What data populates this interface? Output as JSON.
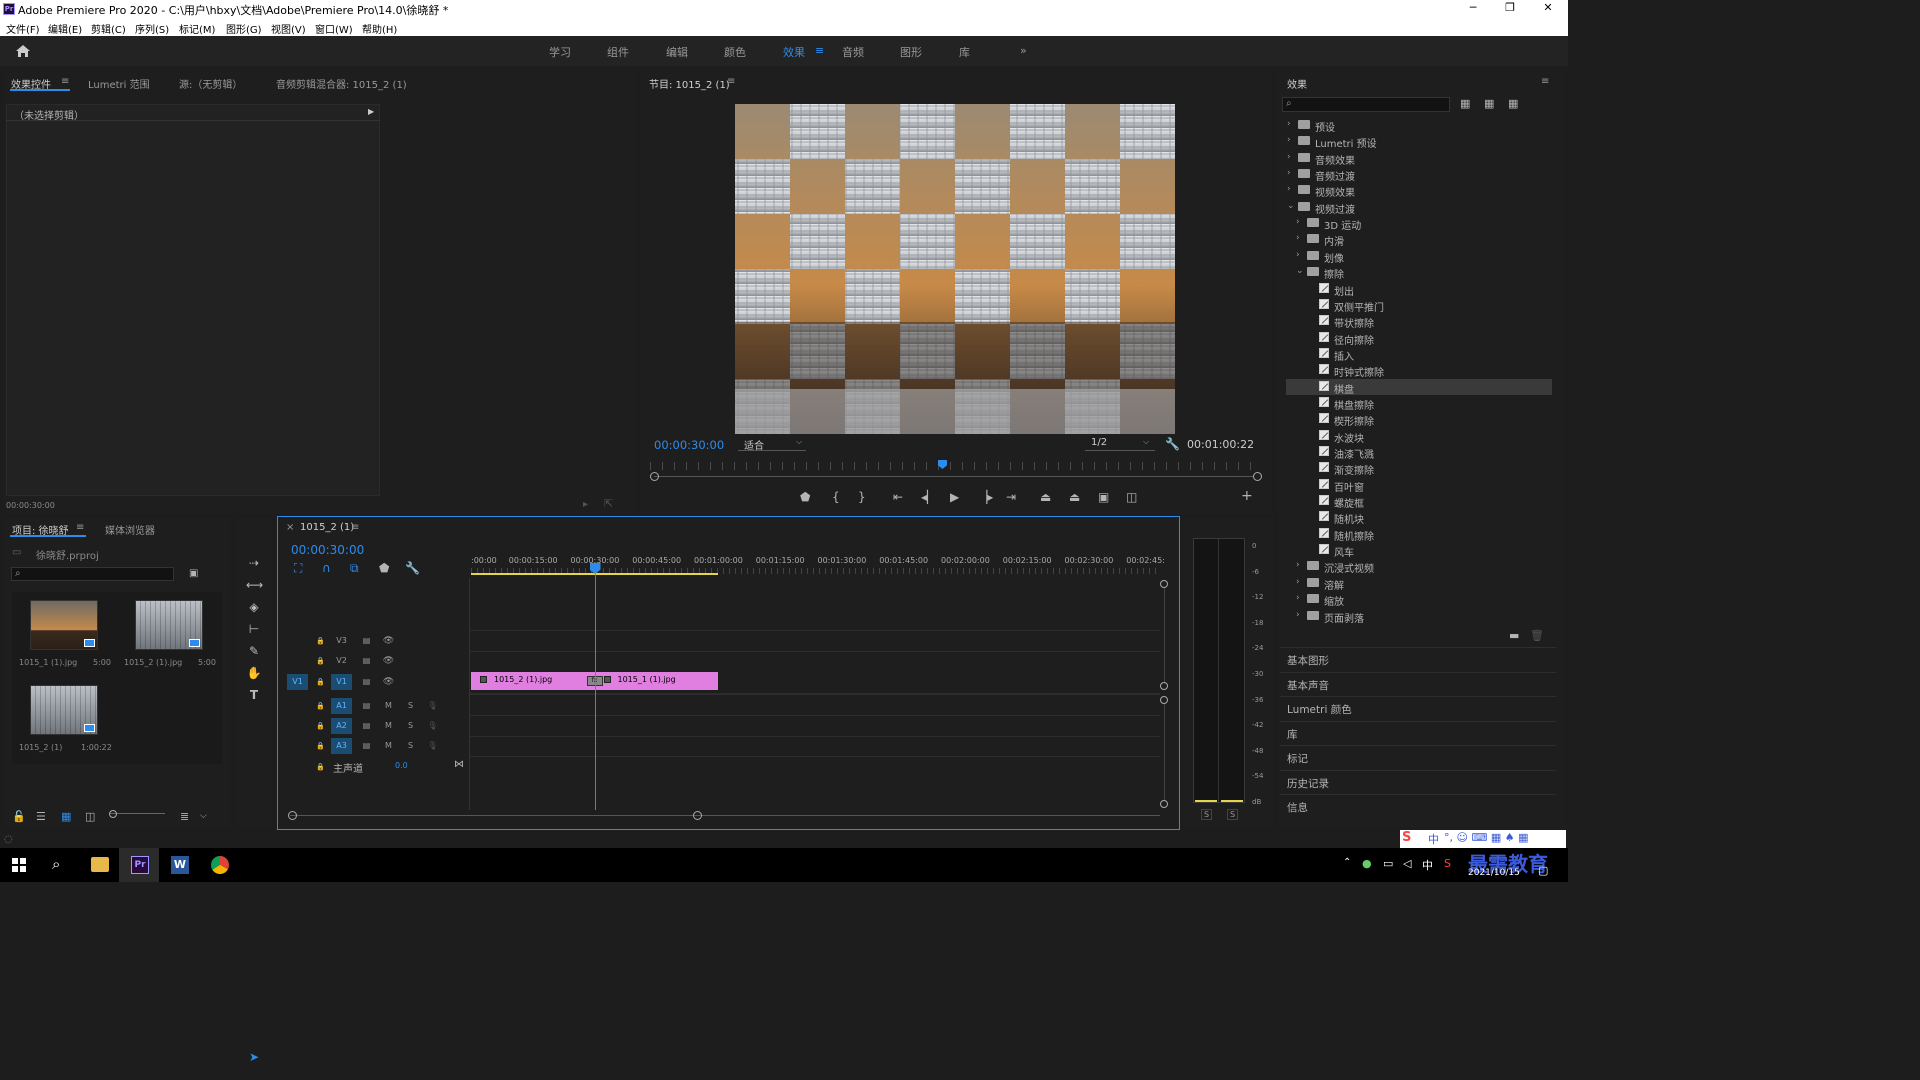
{
  "window": {
    "title": "Adobe Premiere Pro 2020 - C:\\用户\\hbxy\\文档\\Adobe\\Premiere Pro\\14.0\\徐晓舒 *",
    "logo": "Pr",
    "min": "─",
    "max": "❐",
    "close": "✕"
  },
  "menu": [
    "文件(F)",
    "编辑(E)",
    "剪辑(C)",
    "序列(S)",
    "标记(M)",
    "图形(G)",
    "视图(V)",
    "窗口(W)",
    "帮助(H)"
  ],
  "workspaces": [
    "学习",
    "组件",
    "编辑",
    "颜色",
    "效果",
    "音频",
    "图形",
    "库"
  ],
  "workspace_active": "效果",
  "workspace_more": "»",
  "source_panel": {
    "tabs": [
      "效果控件",
      "Lumetri 范围",
      "源:（无剪辑）",
      "音频剪辑混合器: 1015_2 (1)"
    ],
    "no_clip": "（未选择剪辑）",
    "timecode": "00:00:30:00"
  },
  "program": {
    "title": "节目: 1015_2 (1)",
    "timecode": "00:00:30:00",
    "fit": "适合",
    "resolution": "1/2",
    "duration": "00:01:00:22",
    "playhead_fraction": 0.48
  },
  "effects_panel": {
    "title": "效果",
    "items": [
      {
        "label": "预设",
        "level": 0,
        "kind": "folder",
        "open": false
      },
      {
        "label": "Lumetri 预设",
        "level": 0,
        "kind": "folder",
        "open": false
      },
      {
        "label": "音频效果",
        "level": 0,
        "kind": "folder",
        "open": false
      },
      {
        "label": "音频过渡",
        "level": 0,
        "kind": "folder",
        "open": false
      },
      {
        "label": "视频效果",
        "level": 0,
        "kind": "folder",
        "open": false
      },
      {
        "label": "视频过渡",
        "level": 0,
        "kind": "folder",
        "open": true
      },
      {
        "label": "3D 运动",
        "level": 1,
        "kind": "folder",
        "open": false
      },
      {
        "label": "内滑",
        "level": 1,
        "kind": "folder",
        "open": false
      },
      {
        "label": "划像",
        "level": 1,
        "kind": "folder",
        "open": false
      },
      {
        "label": "擦除",
        "level": 1,
        "kind": "folder",
        "open": true
      },
      {
        "label": "划出",
        "level": 2,
        "kind": "effect"
      },
      {
        "label": "双侧平推门",
        "level": 2,
        "kind": "effect"
      },
      {
        "label": "带状擦除",
        "level": 2,
        "kind": "effect"
      },
      {
        "label": "径向擦除",
        "level": 2,
        "kind": "effect"
      },
      {
        "label": "插入",
        "level": 2,
        "kind": "effect"
      },
      {
        "label": "时钟式擦除",
        "level": 2,
        "kind": "effect"
      },
      {
        "label": "棋盘",
        "level": 2,
        "kind": "effect",
        "selected": true
      },
      {
        "label": "棋盘擦除",
        "level": 2,
        "kind": "effect"
      },
      {
        "label": "楔形擦除",
        "level": 2,
        "kind": "effect"
      },
      {
        "label": "水波块",
        "level": 2,
        "kind": "effect"
      },
      {
        "label": "油漆飞溅",
        "level": 2,
        "kind": "effect"
      },
      {
        "label": "渐变擦除",
        "level": 2,
        "kind": "effect"
      },
      {
        "label": "百叶窗",
        "level": 2,
        "kind": "effect"
      },
      {
        "label": "螺旋框",
        "level": 2,
        "kind": "effect"
      },
      {
        "label": "随机块",
        "level": 2,
        "kind": "effect"
      },
      {
        "label": "随机擦除",
        "level": 2,
        "kind": "effect"
      },
      {
        "label": "风车",
        "level": 2,
        "kind": "effect"
      },
      {
        "label": "沉浸式视频",
        "level": 1,
        "kind": "folder",
        "open": false
      },
      {
        "label": "溶解",
        "level": 1,
        "kind": "folder",
        "open": false
      },
      {
        "label": "缩放",
        "level": 1,
        "kind": "folder",
        "open": false
      },
      {
        "label": "页面剥落",
        "level": 1,
        "kind": "folder",
        "open": false
      }
    ],
    "sections": [
      "基本图形",
      "基本声音",
      "Lumetri 颜色",
      "库",
      "标记",
      "历史记录",
      "信息"
    ]
  },
  "project": {
    "tabs": [
      "项目: 徐晓舒",
      "媒体浏览器"
    ],
    "file": "徐晓舒.prproj",
    "items": [
      {
        "name": "1015_1 (1).jpg",
        "duration": "5:00",
        "kind": "sunset"
      },
      {
        "name": "1015_2 (1).jpg",
        "duration": "5:00",
        "kind": "hall"
      },
      {
        "name": "1015_2 (1)",
        "duration": "1:00:22",
        "kind": "hall"
      }
    ]
  },
  "timeline": {
    "tab": "1015_2 (1)",
    "close": "×",
    "timecode": "00:00:30:00",
    "ruler": [
      ":00:00",
      "00:00:15:00",
      "00:00:30:00",
      "00:00:45:00",
      "00:01:00:00",
      "00:01:15:00",
      "00:01:30:00",
      "00:01:45:00",
      "00:02:00:00",
      "00:02:15:00",
      "00:02:30:00",
      "00:02:45:"
    ],
    "video_tracks": [
      "V3",
      "V2",
      "V1"
    ],
    "audio_tracks": [
      "A1",
      "A2",
      "A3"
    ],
    "master": {
      "label": "主声道",
      "value": "0.0"
    },
    "source_patch": "V1",
    "mute": "M",
    "solo": "S",
    "clips": [
      {
        "name": "1015_2 (1).jpg",
        "start": 0,
        "end": 30
      },
      {
        "name": "1015_1 (1).jpg",
        "start": 30,
        "end": 60
      }
    ],
    "transition_fx": "fx"
  },
  "meter": {
    "scale": [
      "0",
      "-6",
      "-12",
      "-18",
      "-24",
      "-30",
      "-36",
      "-42",
      "-48",
      "-54",
      "dB"
    ],
    "solo": [
      "S",
      "S"
    ]
  },
  "taskbar": {
    "date": "2021/10/15",
    "ime": "中",
    "watermark": "最需教育",
    "apps": [
      {
        "name": "Pr",
        "bg": "#2a0a3d",
        "fg": "#9999ff"
      },
      {
        "name": "W",
        "bg": "#2b579a",
        "fg": "#ffffff"
      }
    ]
  },
  "colors": {
    "accent": "#2d8ceb",
    "clip": "#e07fe0",
    "playhead": "#2d8ceb"
  }
}
